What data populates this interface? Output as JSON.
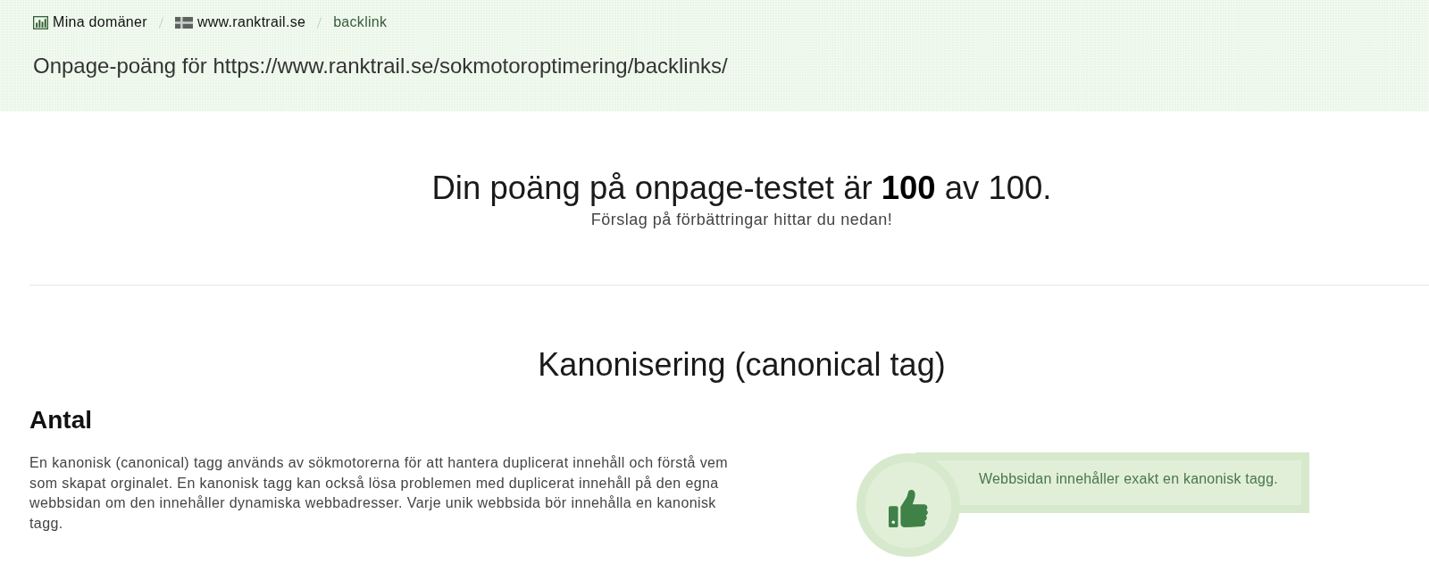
{
  "breadcrumb": [
    {
      "label": "Mina domäner",
      "kind": "chart",
      "current": false
    },
    {
      "label": "www.ranktrail.se",
      "kind": "flag",
      "current": false
    },
    {
      "label": "backlink",
      "kind": "text",
      "current": true
    }
  ],
  "page_title": "Onpage-poäng för https://www.ranktrail.se/sokmotoroptimering/backlinks/",
  "score": {
    "text": "Din poäng på onpage-testet är **100** av 100.",
    "subtitle": "Förslag på förbättringar hittar du nedan!"
  },
  "sections": [
    {
      "title": "Kanonisering (canonical tag)",
      "checks": [
        {
          "heading": "Antal",
          "description": "En kanonisk (canonical) tagg används av sökmotorerna för att hantera duplicerat innehåll och förstå vem som skapat orginalet. En kanonisk tagg kan också lösa problemen med duplicerat innehåll på den egna webbsidan om den innehåller dynamiska webbadresser. Varje unik webbsida bör innehålla en kanonisk tagg.",
          "result": {
            "passed": true,
            "message": "Webbsidan innehåller exakt en kanonisk tagg."
          }
        }
      ]
    }
  ]
}
